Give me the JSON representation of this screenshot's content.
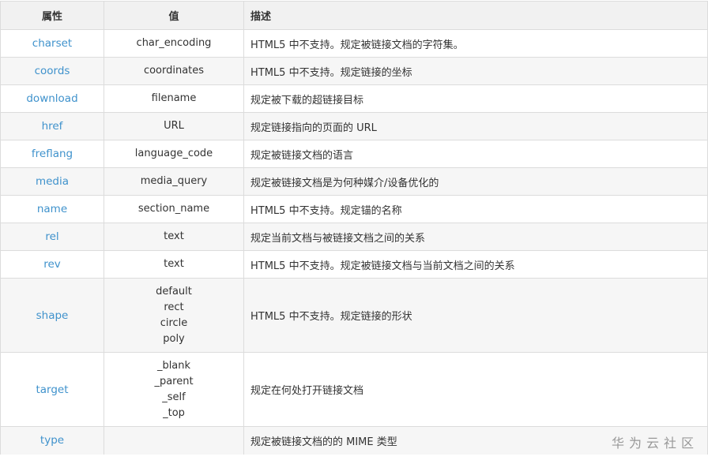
{
  "header": {
    "attr": "属性",
    "value": "值",
    "desc": "描述"
  },
  "rows": [
    {
      "attr": "charset",
      "values": [
        "char_encoding"
      ],
      "desc": "HTML5 中不支持。规定被链接文档的字符集。"
    },
    {
      "attr": "coords",
      "values": [
        "coordinates"
      ],
      "desc": "HTML5 中不支持。规定链接的坐标"
    },
    {
      "attr": "download",
      "values": [
        "filename"
      ],
      "desc": "规定被下载的超链接目标"
    },
    {
      "attr": "href",
      "values": [
        "URL"
      ],
      "desc": "规定链接指向的页面的 URL"
    },
    {
      "attr": "freflang",
      "values": [
        "language_code"
      ],
      "desc": "规定被链接文档的语言"
    },
    {
      "attr": "media",
      "values": [
        "media_query"
      ],
      "desc": "规定被链接文档是为何种媒介/设备优化的"
    },
    {
      "attr": "name",
      "values": [
        "section_name"
      ],
      "desc": "HTML5 中不支持。规定锚的名称"
    },
    {
      "attr": "rel",
      "values": [
        "text"
      ],
      "desc": "规定当前文档与被链接文档之间的关系"
    },
    {
      "attr": "rev",
      "values": [
        "text"
      ],
      "desc": "HTML5 中不支持。规定被链接文档与当前文档之间的关系"
    },
    {
      "attr": "shape",
      "values": [
        "default",
        "rect",
        "circle",
        "poly"
      ],
      "desc": "HTML5 中不支持。规定链接的形状"
    },
    {
      "attr": "target",
      "values": [
        "_blank",
        "_parent",
        "_self",
        "_top"
      ],
      "desc": "规定在何处打开链接文档"
    },
    {
      "attr": "type",
      "values": [
        ""
      ],
      "desc": "规定被链接文档的的 MIME 类型"
    }
  ],
  "watermark": "华为云社区"
}
